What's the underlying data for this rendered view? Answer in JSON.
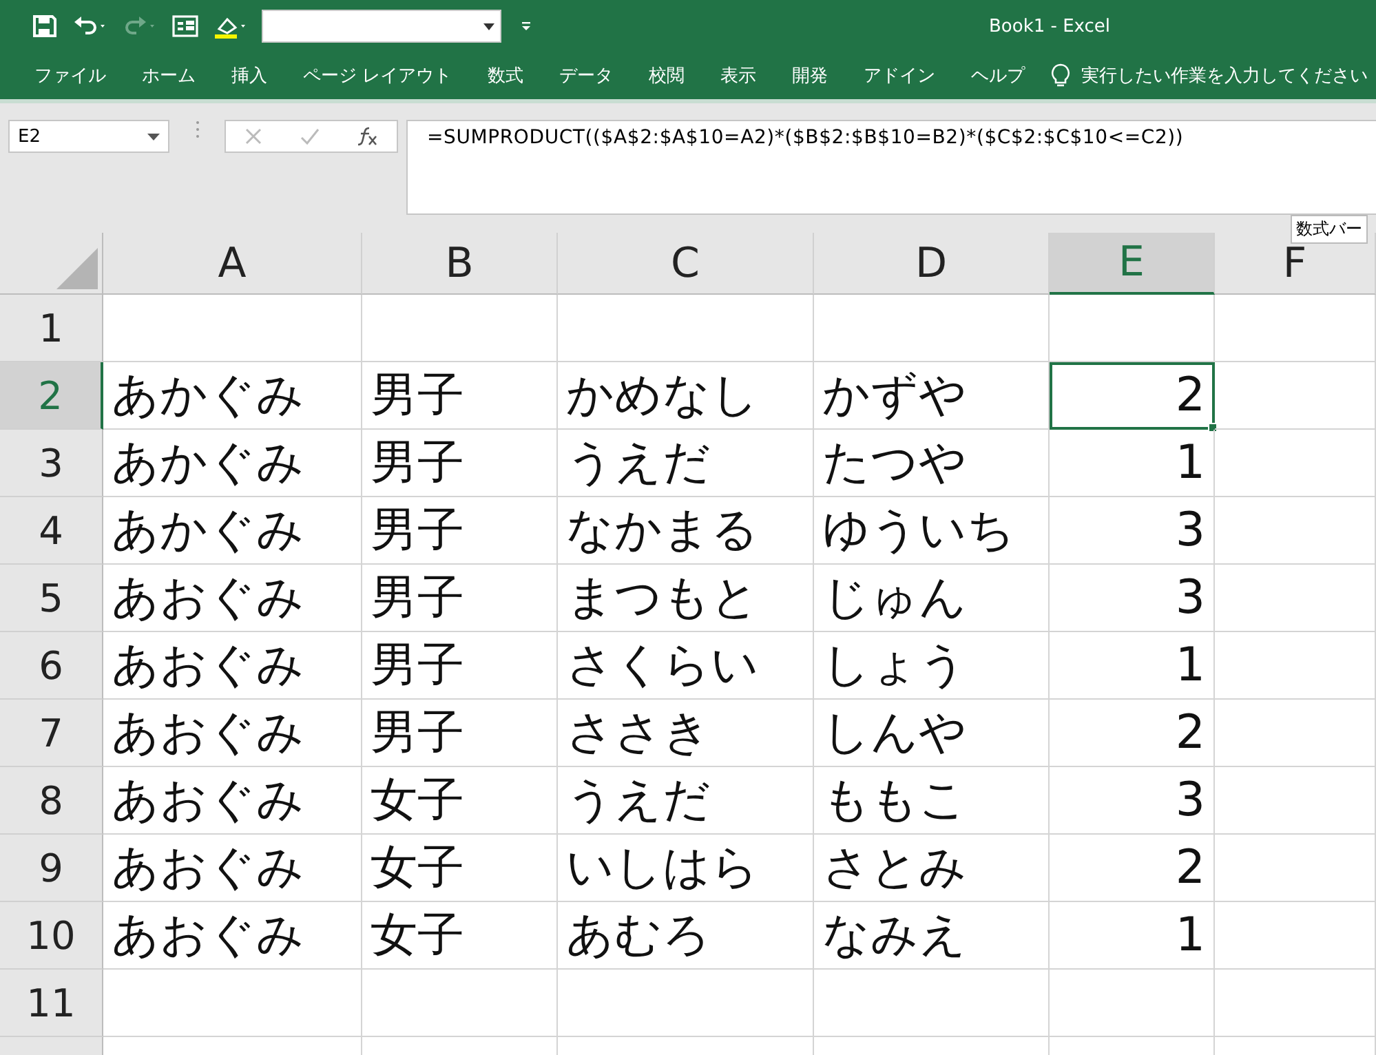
{
  "window": {
    "title": "Book1  -  Excel"
  },
  "ribbon_tabs": [
    "ファイル",
    "ホーム",
    "挿入",
    "ページ レイアウト",
    "数式",
    "データ",
    "校閲",
    "表示",
    "開発",
    "アドイン",
    "ヘルプ"
  ],
  "tell_me": "実行したい作業を入力してください",
  "formula_bar": {
    "name_box": "E2",
    "formula": "=SUMPRODUCT(($A$2:$A$10=A2)*($B$2:$B$10=B2)*($C$2:$C$10<=C2))",
    "tooltip": "数式バー"
  },
  "sheet": {
    "columns": [
      {
        "label": "A",
        "selected": false
      },
      {
        "label": "B",
        "selected": false
      },
      {
        "label": "C",
        "selected": false
      },
      {
        "label": "D",
        "selected": false
      },
      {
        "label": "E",
        "selected": true
      },
      {
        "label": "F",
        "selected": false
      }
    ],
    "rows": [
      {
        "label": "1",
        "selected": false,
        "cells": []
      },
      {
        "label": "2",
        "selected": true,
        "cells": [
          {
            "value": "あかぐみ",
            "kind": "text",
            "selected": false
          },
          {
            "value": "男子",
            "kind": "text",
            "selected": false
          },
          {
            "value": "かめなし",
            "kind": "text",
            "selected": false
          },
          {
            "value": "かずや",
            "kind": "text",
            "selected": false
          },
          {
            "value": "2",
            "kind": "number",
            "selected": true
          }
        ]
      },
      {
        "label": "3",
        "selected": false,
        "cells": [
          {
            "value": "あかぐみ",
            "kind": "text",
            "selected": false
          },
          {
            "value": "男子",
            "kind": "text",
            "selected": false
          },
          {
            "value": "うえだ",
            "kind": "text",
            "selected": false
          },
          {
            "value": "たつや",
            "kind": "text",
            "selected": false
          },
          {
            "value": "1",
            "kind": "number",
            "selected": false
          }
        ]
      },
      {
        "label": "4",
        "selected": false,
        "cells": [
          {
            "value": "あかぐみ",
            "kind": "text",
            "selected": false
          },
          {
            "value": "男子",
            "kind": "text",
            "selected": false
          },
          {
            "value": "なかまる",
            "kind": "text",
            "selected": false
          },
          {
            "value": "ゆういち",
            "kind": "text",
            "selected": false
          },
          {
            "value": "3",
            "kind": "number",
            "selected": false
          }
        ]
      },
      {
        "label": "5",
        "selected": false,
        "cells": [
          {
            "value": "あおぐみ",
            "kind": "text",
            "selected": false
          },
          {
            "value": "男子",
            "kind": "text",
            "selected": false
          },
          {
            "value": "まつもと",
            "kind": "text",
            "selected": false
          },
          {
            "value": "じゅん",
            "kind": "text",
            "selected": false
          },
          {
            "value": "3",
            "kind": "number",
            "selected": false
          }
        ]
      },
      {
        "label": "6",
        "selected": false,
        "cells": [
          {
            "value": "あおぐみ",
            "kind": "text",
            "selected": false
          },
          {
            "value": "男子",
            "kind": "text",
            "selected": false
          },
          {
            "value": "さくらい",
            "kind": "text",
            "selected": false
          },
          {
            "value": "しょう",
            "kind": "text",
            "selected": false
          },
          {
            "value": "1",
            "kind": "number",
            "selected": false
          }
        ]
      },
      {
        "label": "7",
        "selected": false,
        "cells": [
          {
            "value": "あおぐみ",
            "kind": "text",
            "selected": false
          },
          {
            "value": "男子",
            "kind": "text",
            "selected": false
          },
          {
            "value": "ささき",
            "kind": "text",
            "selected": false
          },
          {
            "value": "しんや",
            "kind": "text",
            "selected": false
          },
          {
            "value": "2",
            "kind": "number",
            "selected": false
          }
        ]
      },
      {
        "label": "8",
        "selected": false,
        "cells": [
          {
            "value": "あおぐみ",
            "kind": "text",
            "selected": false
          },
          {
            "value": "女子",
            "kind": "text",
            "selected": false
          },
          {
            "value": "うえだ",
            "kind": "text",
            "selected": false
          },
          {
            "value": "ももこ",
            "kind": "text",
            "selected": false
          },
          {
            "value": "3",
            "kind": "number",
            "selected": false
          }
        ]
      },
      {
        "label": "9",
        "selected": false,
        "cells": [
          {
            "value": "あおぐみ",
            "kind": "text",
            "selected": false
          },
          {
            "value": "女子",
            "kind": "text",
            "selected": false
          },
          {
            "value": "いしはら",
            "kind": "text",
            "selected": false
          },
          {
            "value": "さとみ",
            "kind": "text",
            "selected": false
          },
          {
            "value": "2",
            "kind": "number",
            "selected": false
          }
        ]
      },
      {
        "label": "10",
        "selected": false,
        "cells": [
          {
            "value": "あおぐみ",
            "kind": "text",
            "selected": false
          },
          {
            "value": "女子",
            "kind": "text",
            "selected": false
          },
          {
            "value": "あむろ",
            "kind": "text",
            "selected": false
          },
          {
            "value": "なみえ",
            "kind": "text",
            "selected": false
          },
          {
            "value": "1",
            "kind": "number",
            "selected": false
          }
        ]
      },
      {
        "label": "11",
        "selected": false,
        "cells": []
      }
    ]
  }
}
